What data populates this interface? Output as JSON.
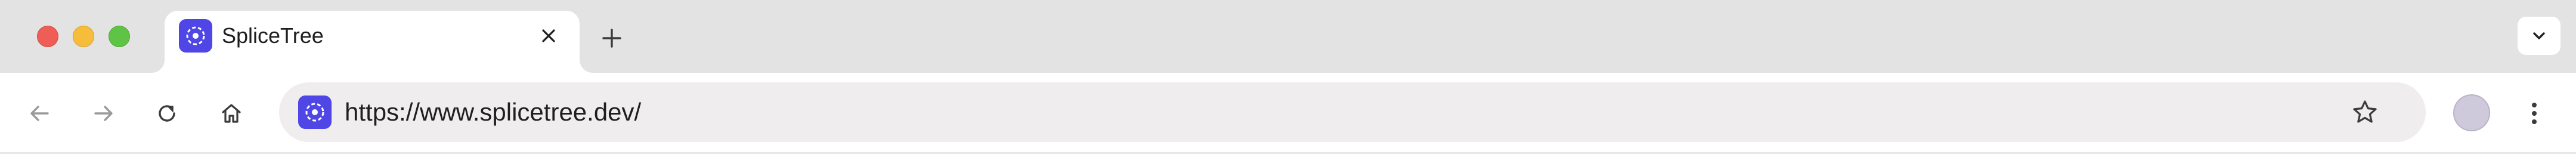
{
  "window": {
    "controls": [
      "close",
      "minimize",
      "maximize"
    ]
  },
  "tabs": [
    {
      "title": "SpliceTree",
      "favicon": "splicetree-logo-icon",
      "active": true
    }
  ],
  "tabstrip": {
    "new_tab_icon": "plus-icon",
    "tab_search_icon": "chevron-down-icon"
  },
  "toolbar": {
    "back_icon": "arrow-left-icon",
    "forward_icon": "arrow-right-icon",
    "reload_icon": "reload-icon",
    "home_icon": "home-icon",
    "url": "https://www.splicetree.dev/",
    "bookmark_icon": "star-icon",
    "menu_icon": "kebab-menu-icon"
  },
  "colors": {
    "brand": "#4f46e5",
    "tabstrip_bg": "#e3e3e3",
    "omnibox_bg": "#efeded"
  }
}
